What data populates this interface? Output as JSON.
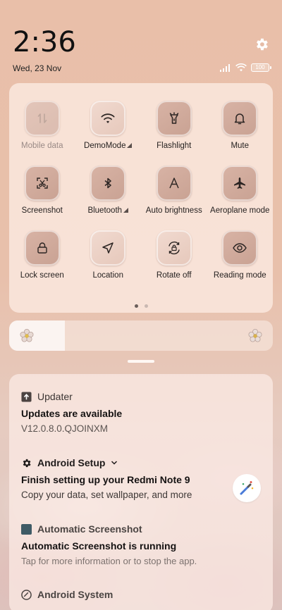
{
  "status": {
    "time": "2:36",
    "date": "Wed, 23 Nov",
    "battery": "100"
  },
  "quick_settings": {
    "tiles": [
      {
        "label": "Mobile data",
        "icon": "mobile-data-icon",
        "state": "disabled"
      },
      {
        "label": "DemoMode",
        "icon": "wifi-icon",
        "state": "on",
        "has_arrow": true
      },
      {
        "label": "Flashlight",
        "icon": "flashlight-icon",
        "state": "off"
      },
      {
        "label": "Mute",
        "icon": "bell-icon",
        "state": "off"
      },
      {
        "label": "Screenshot",
        "icon": "screenshot-icon",
        "state": "off"
      },
      {
        "label": "Bluetooth",
        "icon": "bluetooth-icon",
        "state": "off",
        "has_arrow": true
      },
      {
        "label": "Auto brightness",
        "icon": "auto-brightness-icon",
        "state": "off"
      },
      {
        "label": "Aeroplane mode",
        "icon": "airplane-icon",
        "state": "off"
      },
      {
        "label": "Lock screen",
        "icon": "lock-icon",
        "state": "off"
      },
      {
        "label": "Location",
        "icon": "location-icon",
        "state": "on"
      },
      {
        "label": "Rotate off",
        "icon": "rotate-lock-icon",
        "state": "on"
      },
      {
        "label": "Reading mode",
        "icon": "eye-icon",
        "state": "off"
      }
    ],
    "page_count": 2,
    "active_page": 0
  },
  "brightness": {
    "level": 0.21
  },
  "notifications": {
    "updater": {
      "app": "Updater",
      "title": "Updates are available",
      "text": "V12.0.8.0.QJOINXM"
    },
    "setup": {
      "app": "Android Setup",
      "title": "Finish setting up your Redmi Note 9",
      "text": "Copy your data, set wallpaper, and more"
    },
    "screenshot": {
      "app": "Automatic Screenshot",
      "title": "Automatic Screenshot is running",
      "text": "Tap for more information or to stop the app."
    },
    "system": {
      "app": "Android System"
    }
  },
  "colors": {
    "accent": "#c9a293",
    "panel": "#fae8de"
  }
}
